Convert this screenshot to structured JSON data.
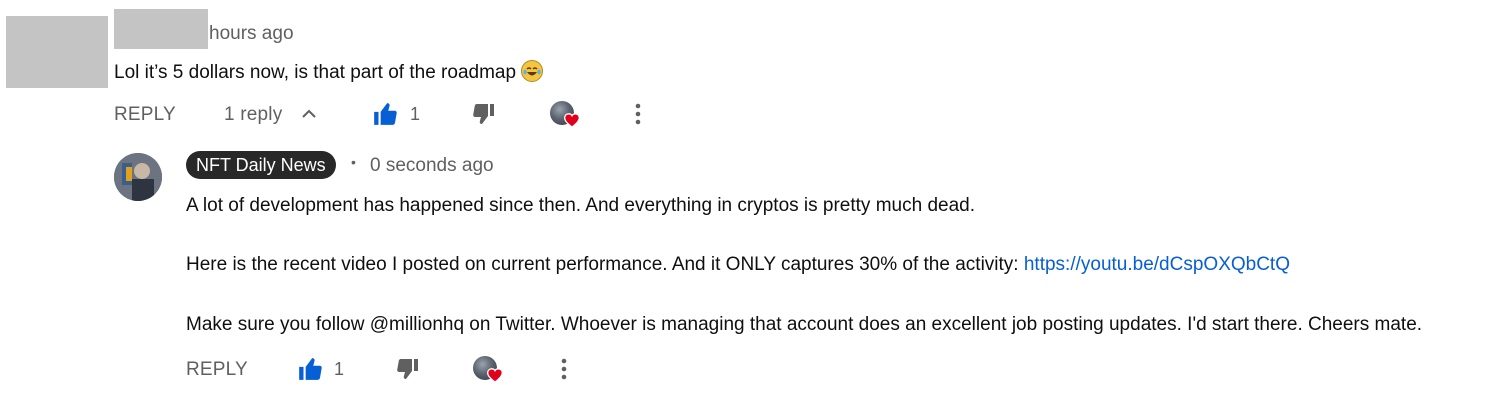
{
  "top_comment": {
    "timestamp": "hours ago",
    "text": "Lol it’s 5 dollars now, is that part of the roadmap",
    "emoji": "😂",
    "reply_label": "REPLY",
    "replies_label": "1 reply",
    "like_count": "1"
  },
  "reply_comment": {
    "author": "NFT Daily News",
    "separator": "•",
    "timestamp": "0 seconds ago",
    "line1": "A lot of development has happened since then. And everything in cryptos is pretty much dead.",
    "line2_text": "Here is the recent video I posted on current performance. And it ONLY captures 30% of the activity: ",
    "line2_link": "https://youtu.be/dCspOXQbCtQ",
    "line3": "Make sure you follow @millionhq on Twitter. Whoever is managing that account does an excellent job posting updates. I'd start there. Cheers mate.",
    "reply_label": "REPLY",
    "like_count": "1"
  },
  "colors": {
    "link": "#065fd4",
    "like_active": "#065fd4",
    "heart": "#e0001b",
    "author_chip": "#282828",
    "redaction": "#c4c4c4"
  }
}
